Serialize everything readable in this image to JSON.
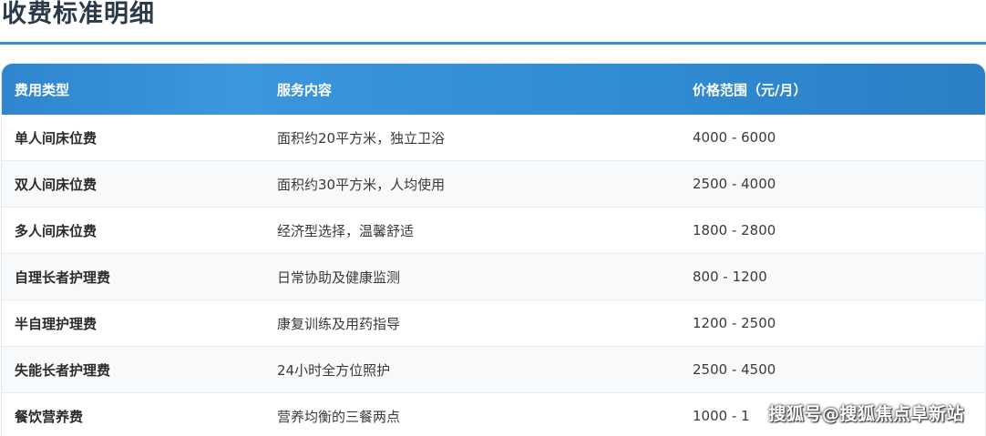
{
  "section": {
    "title": "收费标准明细"
  },
  "table": {
    "headers": [
      "费用类型",
      "服务内容",
      "价格范围（元/月）"
    ],
    "rows": [
      {
        "type": "单人间床位费",
        "content": "面积约20平方米，独立卫浴",
        "price": "4000 - 6000"
      },
      {
        "type": "双人间床位费",
        "content": "面积约30平方米，人均使用",
        "price": "2500 - 4000"
      },
      {
        "type": "多人间床位费",
        "content": "经济型选择，温馨舒适",
        "price": "1800 - 2800"
      },
      {
        "type": "自理长者护理费",
        "content": "日常协助及健康监测",
        "price": "800 - 1200"
      },
      {
        "type": "半自理护理费",
        "content": "康复训练及用药指导",
        "price": "1200 - 2500"
      },
      {
        "type": "失能长者护理费",
        "content": "24小时全方位照护",
        "price": "2500 - 4500"
      },
      {
        "type": "餐饮营养费",
        "content": "营养均衡的三餐两点",
        "price": "1000 - 1"
      }
    ]
  },
  "watermark": {
    "text": "搜狐号@搜狐焦点阜新站"
  },
  "colors": {
    "header_blue": "#2f86cf",
    "rule_blue": "#3b8fd6",
    "title_text": "#2b3a4a"
  }
}
